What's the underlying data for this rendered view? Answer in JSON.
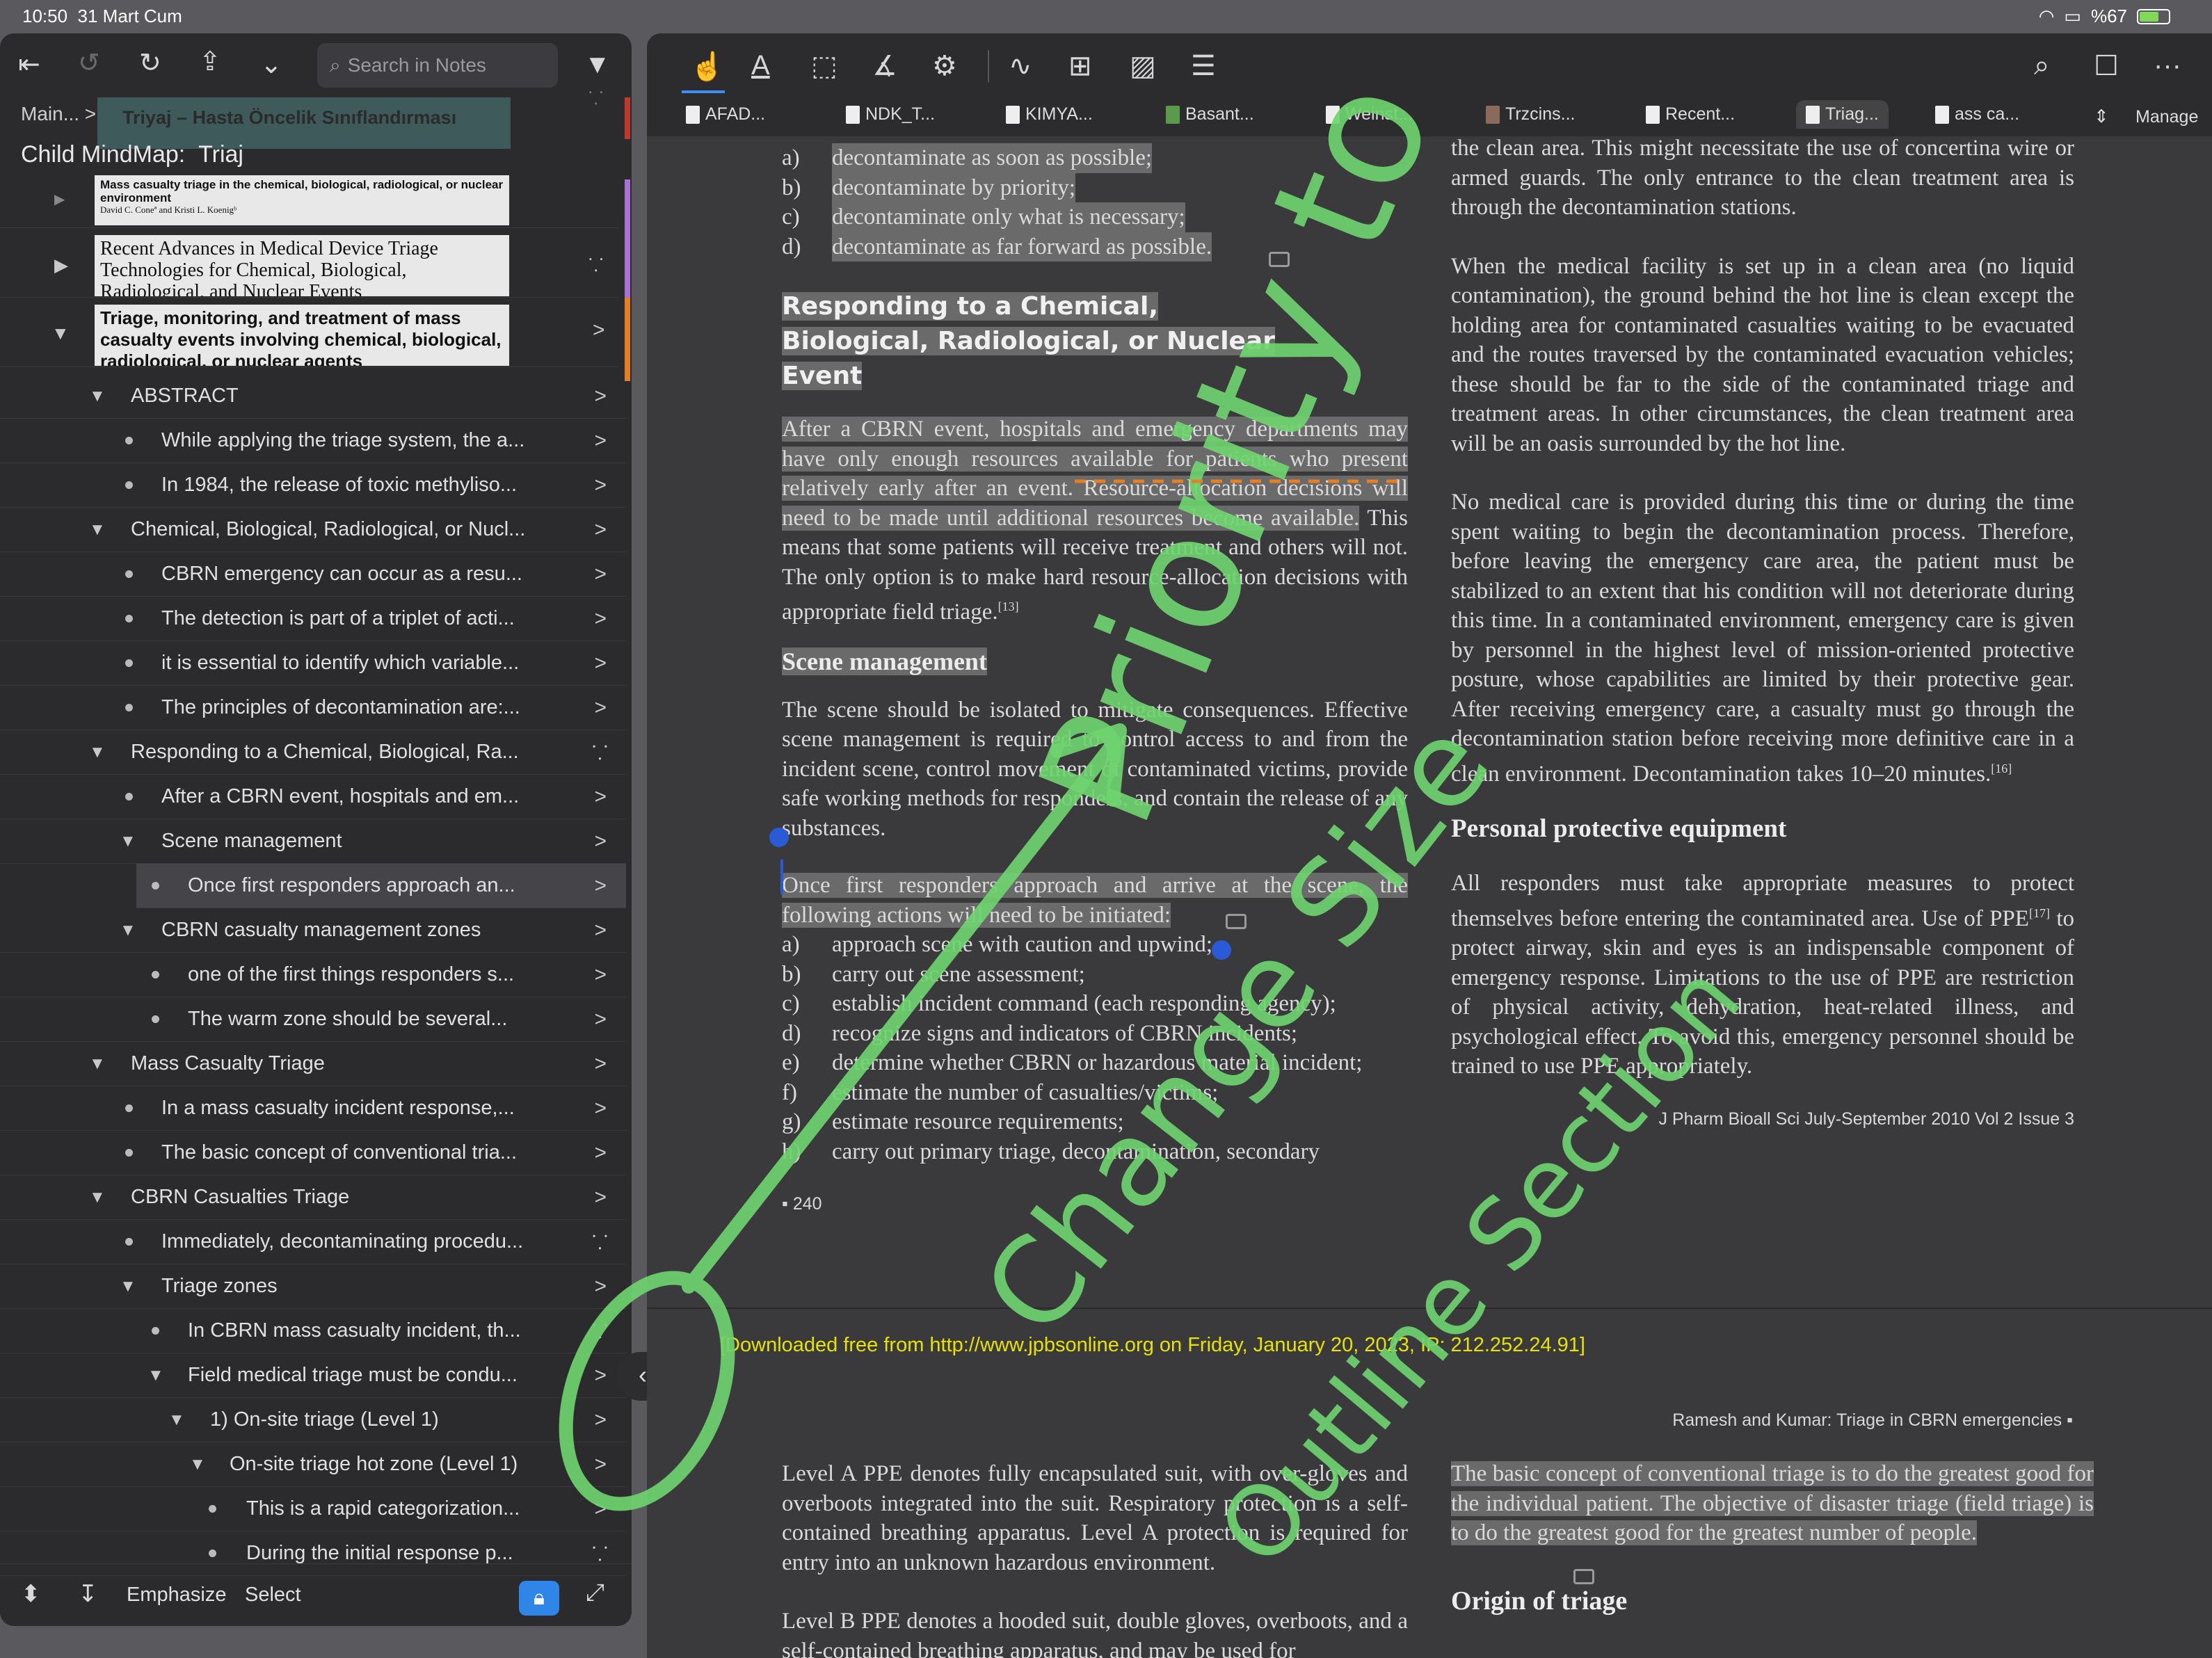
{
  "status": {
    "time": "10:50",
    "date": "31 Mart Cum",
    "battery": "%67"
  },
  "left": {
    "search_placeholder": "Search in Notes",
    "breadcrumb": "Main... >",
    "breadcrumb_box": "Triyaj – Hasta Öncelik Sınıflandırması",
    "child_map_label": "Child MindMap:",
    "child_map_title": "Triaj",
    "thumb1_title": "Mass casualty triage in the chemical, biological, radiological, or nuclear environment",
    "thumb1_authors": "David C. Coneª and Kristi L. Koenigᵇ",
    "thumb2_title": "Recent Advances in Medical Device Triage Technologies for Chemical, Biological, Radiological, and Nuclear Events",
    "thumb3_title": "Triage, monitoring, and treatment of mass casualty events involving chemical, biological, radiological, or nuclear agents",
    "rows": [
      {
        "label": "ABSTRACT"
      },
      {
        "label": "While applying the triage system, the a..."
      },
      {
        "label": "In 1984, the release of toxic methyliso..."
      },
      {
        "label": "Chemical, Biological, Radiological, or Nucl..."
      },
      {
        "label": "CBRN emergency can occur as a resu..."
      },
      {
        "label": "The detection is part of a triplet of acti..."
      },
      {
        "label": "it is essential to identify which variable..."
      },
      {
        "label": "The principles of decontamination are:..."
      },
      {
        "label": "Responding to a Chemical, Biological, Ra..."
      },
      {
        "label": "After a CBRN event, hospitals and em..."
      },
      {
        "label": "Scene management"
      },
      {
        "label": "Once first responders approach an..."
      },
      {
        "label": "CBRN casualty management zones"
      },
      {
        "label": "one of the first things responders s..."
      },
      {
        "label": "The warm zone should be several..."
      },
      {
        "label": "Mass Casualty Triage"
      },
      {
        "label": "In a mass casualty incident response,..."
      },
      {
        "label": "The basic concept of conventional tria..."
      },
      {
        "label": "CBRN Casualties Triage"
      },
      {
        "label": "Immediately, decontaminating procedu..."
      },
      {
        "label": "Triage zones"
      },
      {
        "label": "In CBRN mass casualty incident, th..."
      },
      {
        "label": "Field medical triage must be condu..."
      },
      {
        "label": "1) On-site triage (Level 1)"
      },
      {
        "label": "On-site triage hot zone (Level 1)"
      },
      {
        "label": "This is a rapid categorization..."
      },
      {
        "label": "During the initial response p..."
      }
    ],
    "bottom": {
      "emphasize": "Emphasize",
      "select": "Select"
    }
  },
  "tabs": [
    "AFAD...",
    "NDK_T...",
    "KIMYA...",
    "Basant...",
    "Weinst...",
    "Trzcins...",
    "Recent...",
    "Triag...",
    "ass ca..."
  ],
  "manage": "Manage",
  "doc": {
    "list_top": [
      {
        "k": "a)",
        "t": "decontaminate as soon as possible;"
      },
      {
        "k": "b)",
        "t": "decontaminate by priority;"
      },
      {
        "k": "c)",
        "t": "decontaminate only what is necessary;"
      },
      {
        "k": "d)",
        "t": "decontaminate as far forward as possible."
      }
    ],
    "heading1": "Responding to a Chemical, Biological, Radiological, or Nuclear Event",
    "para1_hl": "After a CBRN event, hospitals and emergency departments may have only enough resources available for patients who present relatively early after an event. Resource-allocation decisions will need to be made until additional resources become available.",
    "para1_rest": " This means that some patients will receive treatment and others will not. The only option is to make hard resource-allocation decisions with appropriate field triage.",
    "para1_ref": "[13]",
    "heading2": "Scene management",
    "para2": "The scene should be isolated to mitigate consequences. Effective scene management is required to control access to and from the incident scene, control movement of contaminated victims, provide safe working methods for responders, and contain the release of any substances.",
    "para3": "Once first responders approach and arrive at the scene, the following actions will need to be initiated:",
    "list_mid": [
      {
        "k": "a)",
        "t": "approach scene with caution and upwind;"
      },
      {
        "k": "b)",
        "t": "carry out scene assessment;"
      },
      {
        "k": "c)",
        "t": "establish incident command (each responding agency);"
      },
      {
        "k": "d)",
        "t": "recognize signs and indicators of CBRN incidents;"
      },
      {
        "k": "e)",
        "t": "determine whether CBRN or hazardous material incident;"
      },
      {
        "k": "f)",
        "t": "estimate the number of casualties/victims;"
      },
      {
        "k": "g)",
        "t": "estimate resource requirements;"
      },
      {
        "k": "h)",
        "t": "carry out primary triage, decontamination, secondary"
      }
    ],
    "page_num": "240",
    "right_p1": "the clean area. This might necessitate the use of concertina wire or armed guards. The only entrance to the clean treatment area is through the decontamination stations.",
    "right_p2": "When the medical facility is set up in a clean area (no liquid contamination), the ground behind the hot line is clean except the holding area for contaminated casualties waiting to be evacuated and the routes traversed by the contaminated evacuation vehicles; these should be far to the side of the contaminated triage and treatment areas. In other circumstances, the clean treatment area will be an oasis surrounded by the hot line.",
    "right_p3": "No medical care is provided during this time or during the time spent waiting to begin the decontamination process. Therefore, before leaving the emergency care area, the patient must be stabilized to an extent that his condition will not deteriorate during this time. In a contaminated environment, emergency care is given by personnel in the highest level of mission-oriented protective posture, whose capabilities are limited by their protective gear. After receiving emergency care, a casualty must go through the decontamination station before receiving more definitive care in a clean environment. Decontamination takes 10–20 minutes.",
    "right_p3_ref": "[16]",
    "heading3": "Personal protective equipment",
    "right_p4": "All responders must take appropriate measures to protect themselves before entering the contaminated area. Use of PPE",
    "right_p4_ref": "[17]",
    "right_p4b": " to protect airway, skin and eyes is an indispensable component of emergency response. Limitations to the use of PPE are restriction of physical activity, dehydration, heat-related illness, and psychological effect. To avoid this, emergency personnel should be trained to use PPE appropriately.",
    "journal_footer": "J Pharm Bioall Sci   July-September 2010   Vol 2   Issue 3",
    "download_line": "[Downloaded free from http://www.jpbsonline.org on Friday, January 20, 2023, IP: 212.252.24.91]",
    "running_head": "Ramesh and Kumar: Triage in CBRN emergencies",
    "p2_left1": "Level A PPE denotes fully encapsulated suit, with over-gloves and overboots integrated into the suit. Respiratory protection is a self-contained breathing apparatus. Level A protection is required for entry into an unknown hazardous environment.",
    "p2_left2": "Level B PPE denotes a hooded suit, double gloves, overboots, and a self-contained breathing apparatus, and may be used for",
    "p2_right_hl": "The basic concept of conventional triage is to do the greatest good for the individual patient. The objective of disaster triage (field triage) is to do the greatest good for the greatest number of people.",
    "heading4": "Origin of triage"
  },
  "handwriting": {
    "text1": "Priority to",
    "text2": "Change Size",
    "text3": "Outline Section"
  },
  "colors": {
    "ink": "#6fd46f",
    "accent": "#2f86e8",
    "download": "#e6e300"
  }
}
